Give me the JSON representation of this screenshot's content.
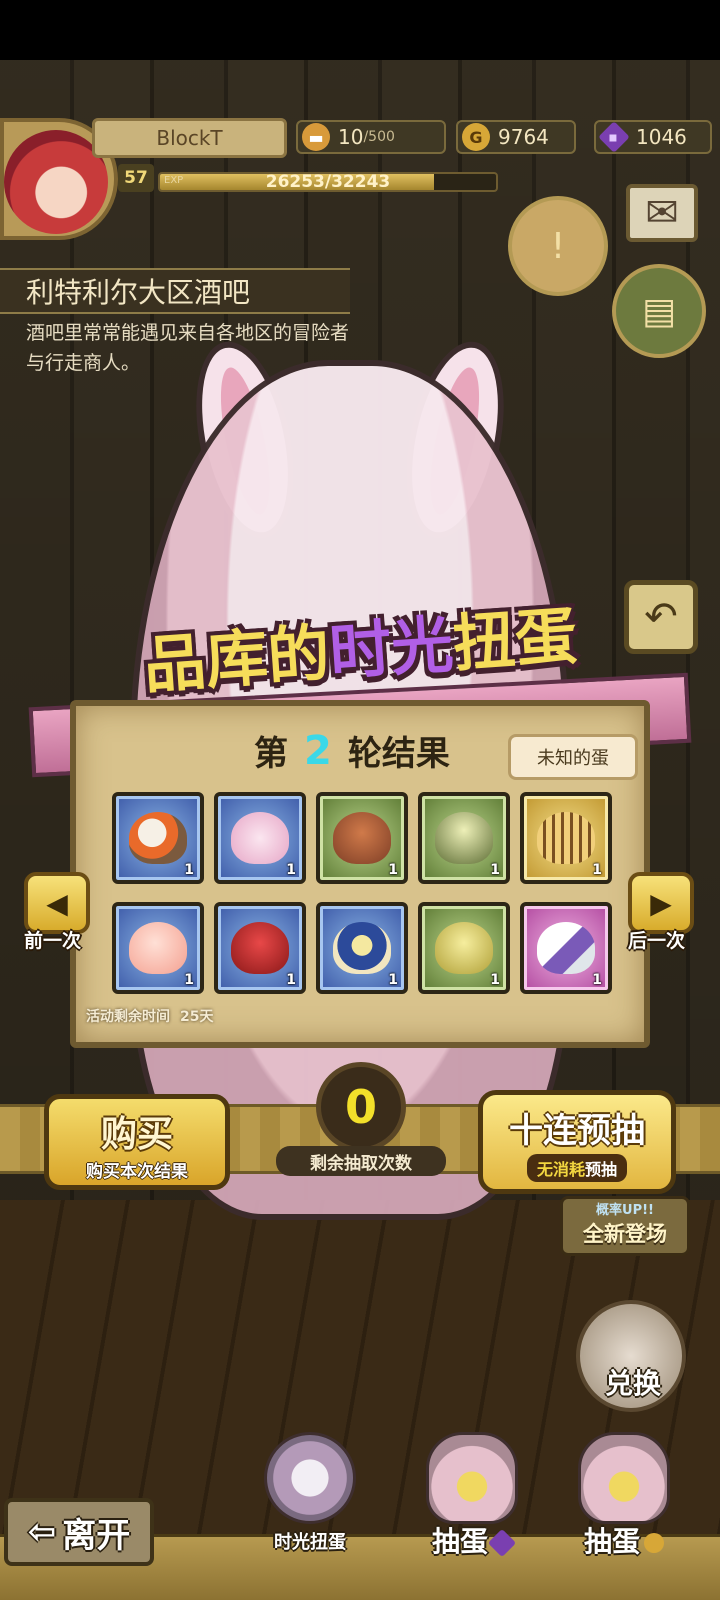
{
  "player": {
    "name": "BlockT",
    "level": "57",
    "exp_label": "EXP",
    "exp_current": "26253",
    "exp_max": "/32243",
    "exp_fraction": 0.814
  },
  "resources": {
    "food": "10",
    "food_max": "/500",
    "gold_icon": "G",
    "gold": "9764",
    "gems": "1046"
  },
  "location": {
    "name": "利特利尔大区酒吧",
    "description": "酒吧里常常能遇见来自各地区的冒险者与行走商人。"
  },
  "gacha": {
    "title_prefix": "品库的",
    "title_highlight": "时光",
    "title_suffix": "扭蛋",
    "round_prefix": "第",
    "round_number": "2",
    "round_suffix": "轮结果",
    "unknown_egg_label": "未知的蛋",
    "remaining_time_label": "活动剩余时间",
    "remaining_time_value": "25天",
    "prev_label": "前一次",
    "next_label": "后一次",
    "items": [
      {
        "icon": "fire-cannon-icon",
        "rarity": "blue",
        "count": "1"
      },
      {
        "icon": "pink-egg-icon",
        "rarity": "blue",
        "count": "1"
      },
      {
        "icon": "lava-rock-egg-icon",
        "rarity": "green",
        "count": "1"
      },
      {
        "icon": "green-armored-egg-icon",
        "rarity": "green",
        "count": "1"
      },
      {
        "icon": "tiger-egg-icon",
        "rarity": "gold",
        "count": "1"
      },
      {
        "icon": "peach-icon",
        "rarity": "blue",
        "count": "1"
      },
      {
        "icon": "red-helmet-egg-icon",
        "rarity": "blue",
        "count": "1"
      },
      {
        "icon": "blue-star-egg-icon",
        "rarity": "blue",
        "count": "1"
      },
      {
        "icon": "yellow-cracked-egg-icon",
        "rarity": "green",
        "count": "1"
      },
      {
        "icon": "feather-egg-icon",
        "rarity": "pink",
        "count": "1"
      }
    ]
  },
  "actions": {
    "buy_label": "购买",
    "buy_sub": "购买本次结果",
    "remaining_draws": "0",
    "remaining_draws_label": "剩余抽取次数",
    "ten_pull_label": "十连预抽",
    "ten_pull_sub_a": "无消耗",
    "ten_pull_sub_b": "预抽",
    "new_badge_prob": "概率UP!!",
    "new_badge_label": "全新登场",
    "exchange_label": "兑换",
    "leave_label": "离开"
  },
  "dock": {
    "time_gacha": "时光扭蛋",
    "draw_gem": "抽蛋",
    "draw_gold": "抽蛋"
  },
  "colors": {
    "rarity_blue": "#3d5aa8",
    "rarity_green": "#5d7a34",
    "rarity_gold": "#c0962e",
    "rarity_pink": "#b24aa0",
    "gem": "#7a3fb0",
    "gold": "#d7a737",
    "highlight_number": "#3ad8e8",
    "draw_count": "#f3e02a"
  }
}
